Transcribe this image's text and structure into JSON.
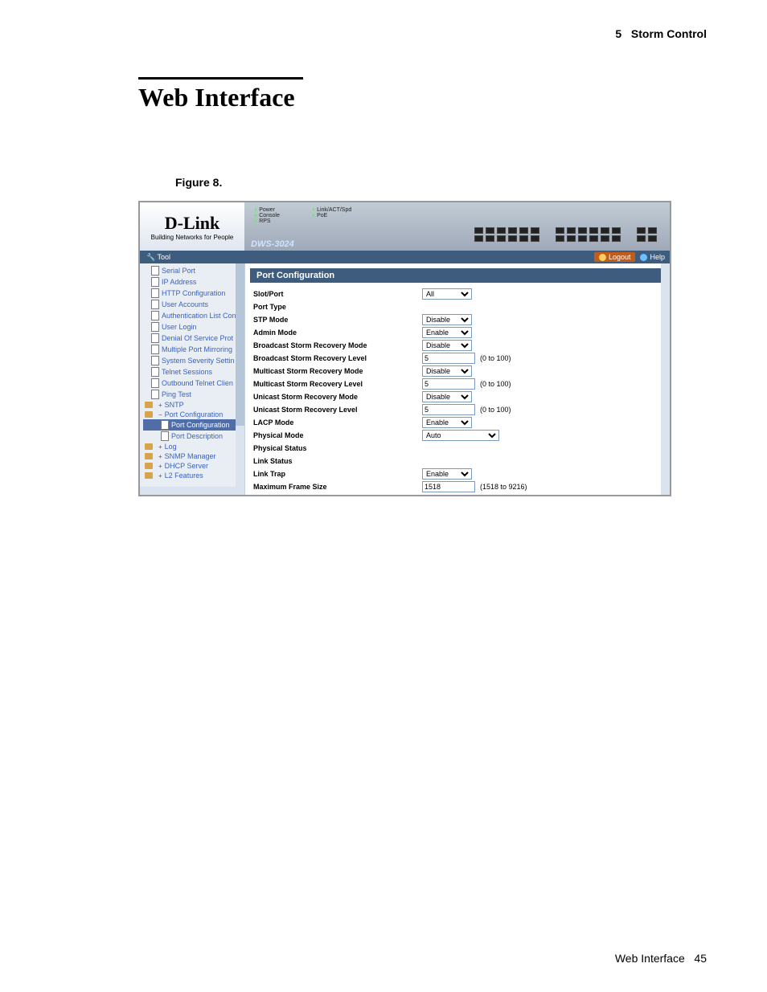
{
  "page_header": {
    "section_num": "5",
    "section_title": "Storm Control"
  },
  "title": "Web Interface",
  "figure_label": "Figure 8.",
  "footer": {
    "text": "Web Interface",
    "page": "45"
  },
  "brand": {
    "name": "D-Link",
    "tagline": "Building Networks for People",
    "model": "DWS-3024"
  },
  "leds": {
    "power": "Power",
    "console": "Console",
    "rps": "RPS",
    "link": "Link/ACT/Spd",
    "poe": "PoE"
  },
  "toolbar": {
    "tool": "Tool",
    "logout": "Logout",
    "help": "Help"
  },
  "sidebar": {
    "items": [
      {
        "label": "Serial Port",
        "type": "doc"
      },
      {
        "label": "IP Address",
        "type": "doc"
      },
      {
        "label": "HTTP Configuration",
        "type": "doc"
      },
      {
        "label": "User Accounts",
        "type": "doc"
      },
      {
        "label": "Authentication List Con",
        "type": "doc"
      },
      {
        "label": "User Login",
        "type": "doc"
      },
      {
        "label": "Denial Of Service Prot",
        "type": "doc"
      },
      {
        "label": "Multiple Port Mirroring",
        "type": "doc"
      },
      {
        "label": "System Severity Settin",
        "type": "doc"
      },
      {
        "label": "Telnet Sessions",
        "type": "doc"
      },
      {
        "label": "Outbound Telnet Clien",
        "type": "doc"
      },
      {
        "label": "Ping Test",
        "type": "doc"
      },
      {
        "label": "SNTP",
        "type": "folder",
        "sign": "+"
      },
      {
        "label": "Port Configuration",
        "type": "folder",
        "sign": "−",
        "open": true
      },
      {
        "label": "Port Configuration",
        "type": "doc",
        "indent": 1,
        "sel": true
      },
      {
        "label": "Port Description",
        "type": "doc",
        "indent": 1
      },
      {
        "label": "Log",
        "type": "folder",
        "sign": "+"
      },
      {
        "label": "SNMP Manager",
        "type": "folder",
        "sign": "+"
      },
      {
        "label": "DHCP Server",
        "type": "folder",
        "sign": "+"
      },
      {
        "label": "L2 Features",
        "type": "folder",
        "sign": "+"
      }
    ]
  },
  "panel": {
    "title": "Port Configuration",
    "rows": [
      {
        "label": "Slot/Port",
        "ctrl": "select",
        "value": "All"
      },
      {
        "label": "Port Type",
        "ctrl": "text",
        "value": ""
      },
      {
        "label": "STP Mode",
        "ctrl": "select",
        "value": "Disable"
      },
      {
        "label": "Admin Mode",
        "ctrl": "select",
        "value": "Enable"
      },
      {
        "label": "Broadcast Storm Recovery Mode",
        "ctrl": "select",
        "value": "Disable"
      },
      {
        "label": "Broadcast Storm Recovery Level",
        "ctrl": "input",
        "value": "5",
        "hint": "(0 to 100)"
      },
      {
        "label": "Multicast Storm Recovery Mode",
        "ctrl": "select",
        "value": "Disable"
      },
      {
        "label": "Multicast Storm Recovery Level",
        "ctrl": "input",
        "value": "5",
        "hint": "(0 to 100)"
      },
      {
        "label": "Unicast Storm Recovery Mode",
        "ctrl": "select",
        "value": "Disable"
      },
      {
        "label": "Unicast Storm Recovery Level",
        "ctrl": "input",
        "value": "5",
        "hint": "(0 to 100)"
      },
      {
        "label": "LACP Mode",
        "ctrl": "select",
        "value": "Enable"
      },
      {
        "label": "Physical Mode",
        "ctrl": "select-wide",
        "value": "Auto"
      },
      {
        "label": "Physical Status",
        "ctrl": "text",
        "value": ""
      },
      {
        "label": "Link Status",
        "ctrl": "text",
        "value": ""
      },
      {
        "label": "Link Trap",
        "ctrl": "select",
        "value": "Enable"
      },
      {
        "label": "Maximum Frame Size",
        "ctrl": "input",
        "value": "1518",
        "hint": "(1518 to 9216)"
      }
    ]
  }
}
